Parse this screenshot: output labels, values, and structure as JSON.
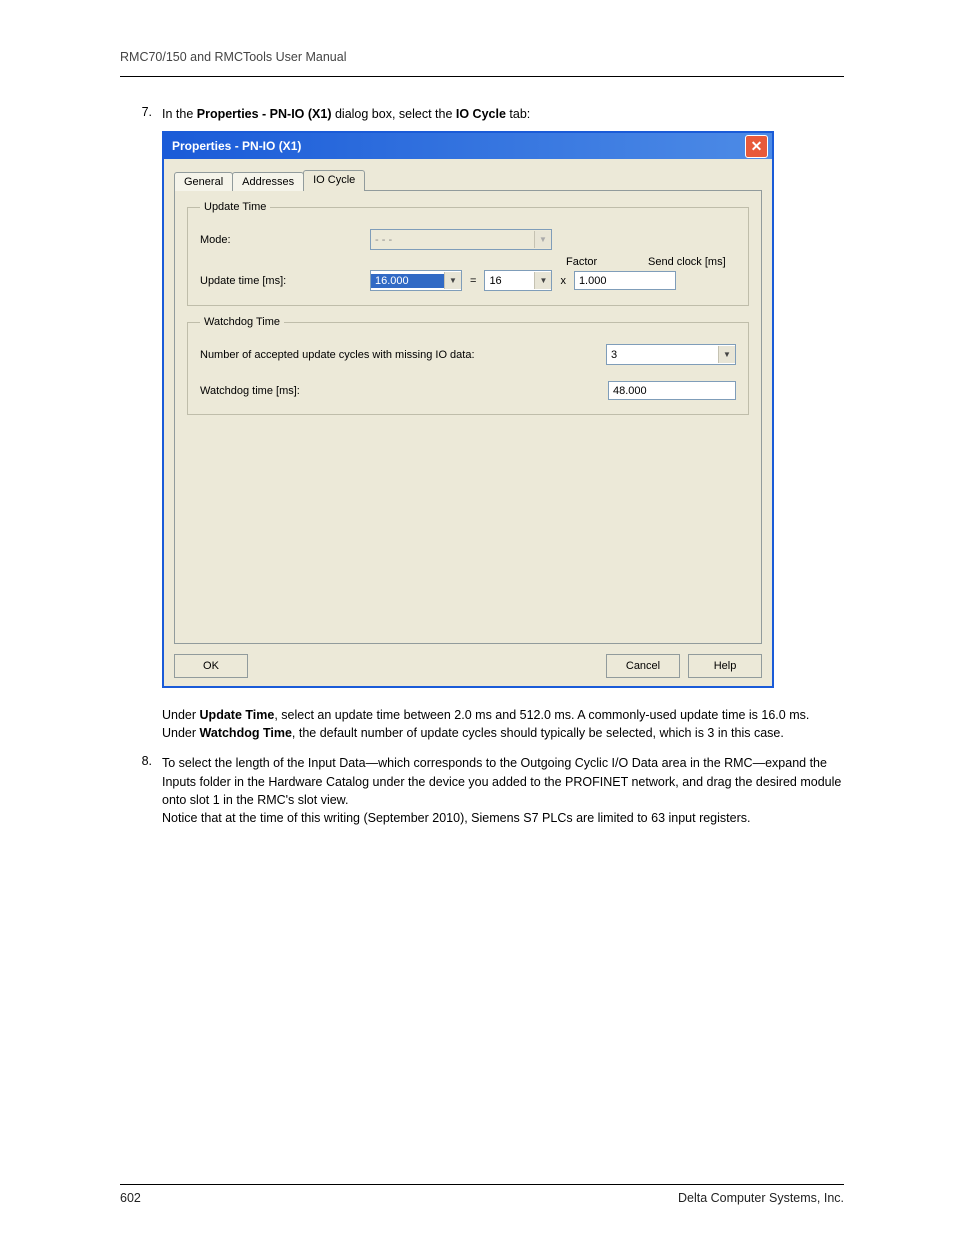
{
  "header": {
    "title": "RMC70/150 and RMCTools User Manual"
  },
  "steps": {
    "s7": {
      "num": "7.",
      "intro_a": "In the ",
      "intro_b": "Properties - PN-IO (X1)",
      "intro_c": " dialog box, select the ",
      "intro_d": "IO Cycle",
      "intro_e": " tab:",
      "note1_a": "Under ",
      "note1_b": "Update Time",
      "note1_c": ", select an update time between 2.0 ms and 512.0 ms. A commonly-used update time is 16.0 ms.",
      "note2_a": "Under ",
      "note2_b": "Watchdog Time",
      "note2_c": ", the default number of update cycles should typically be selected, which is 3 in this case."
    },
    "s8": {
      "num": "8.",
      "text": "To select the length of the Input Data—which corresponds to the Outgoing Cyclic I/O Data area in the RMC—expand the Inputs folder in the Hardware Catalog under the device you added to the PROFINET network, and drag the desired module onto slot 1 in the RMC's slot view.",
      "notice": "Notice that at the time of this writing (September 2010), Siemens S7 PLCs are limited to 63 input registers."
    }
  },
  "dialog": {
    "title": "Properties - PN-IO (X1)",
    "close": "✕",
    "tabs": {
      "general": "General",
      "addresses": "Addresses",
      "iocycle": "IO Cycle"
    },
    "update_time": {
      "legend": "Update Time",
      "mode_label": "Mode:",
      "mode_value": "- - -",
      "ut_label": "Update time [ms]:",
      "ut_value": "16.000",
      "eq": "=",
      "factor_header": "Factor",
      "factor_value": "16",
      "x": "x",
      "sendclock_header": "Send clock [ms]",
      "sendclock_value": "1.000"
    },
    "watchdog_time": {
      "legend": "Watchdog Time",
      "cycles_label": "Number of accepted update cycles with missing IO data:",
      "cycles_value": "3",
      "wt_label": "Watchdog time [ms]:",
      "wt_value": "48.000"
    },
    "buttons": {
      "ok": "OK",
      "cancel": "Cancel",
      "help": "Help"
    }
  },
  "footer": {
    "page": "602",
    "company": "Delta Computer Systems, Inc."
  }
}
